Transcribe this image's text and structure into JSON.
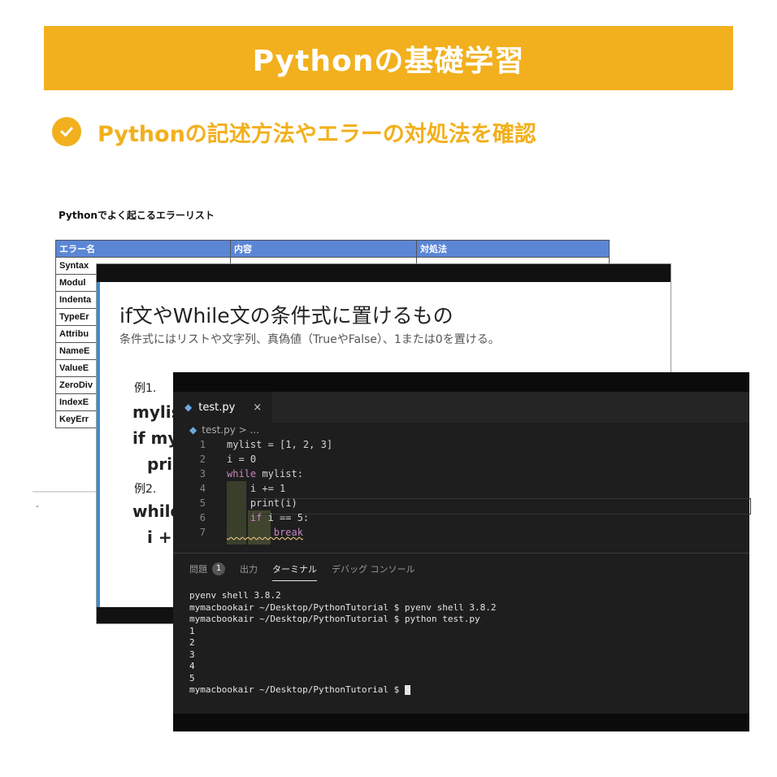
{
  "banner": {
    "title": "Pythonの基礎学習"
  },
  "subheading": {
    "text": "Pythonの記述方法やエラーの対処法を確認"
  },
  "spreadsheet": {
    "title": "Pythonでよく起こるエラーリスト",
    "headers": [
      "エラー名",
      "内容",
      "対処法"
    ],
    "rows": [
      "Syntax",
      "Modul",
      "Indenta",
      "TypeEr",
      "Attribu",
      "NameE",
      "ValueE",
      "ZeroDiv",
      "IndexE",
      "KeyErr"
    ],
    "sheet_tab": "-"
  },
  "slide": {
    "title": "if文やWhile文の条件式に置けるもの",
    "subtitle": "条件式にはリストや文字列、真偽値（TrueやFalse）、1または0を置ける。",
    "example1_label": "例1.",
    "example1_line1": "mylis",
    "example1_line2": "if my",
    "example1_line3": "prir",
    "example2_label": "例2.",
    "example2_line1": "while",
    "example2_line2": "i +="
  },
  "editor": {
    "tab": {
      "filename": "test.py",
      "close": "×"
    },
    "breadcrumb": "test.py > ...",
    "code_lines": [
      {
        "n": "1",
        "text": "mylist = [1, 2, 3]"
      },
      {
        "n": "2",
        "text": "i = 0"
      },
      {
        "n": "3",
        "kw": "while",
        "text": " mylist:"
      },
      {
        "n": "4",
        "text": "    i += 1"
      },
      {
        "n": "5",
        "text": "    print(i)"
      },
      {
        "n": "6",
        "kw": "    if",
        "text": " i == 5:"
      },
      {
        "n": "7",
        "kw": "        break",
        "text": ""
      }
    ],
    "panel_tabs": {
      "problems": "問題",
      "problems_count": "1",
      "output": "出力",
      "terminal": "ターミナル",
      "debug_console": "デバッグ コンソール"
    },
    "terminal_lines": [
      "pyenv shell 3.8.2",
      "mymacbookair ~/Desktop/PythonTutorial $ pyenv shell 3.8.2",
      "mymacbookair ~/Desktop/PythonTutorial $ python test.py",
      "1",
      "2",
      "3",
      "4",
      "5",
      "mymacbookair ~/Desktop/PythonTutorial $ "
    ]
  },
  "colors": {
    "accent": "#f2b01e",
    "sheet_header": "#5b86d6",
    "editor_bg": "#1e1e1e"
  }
}
